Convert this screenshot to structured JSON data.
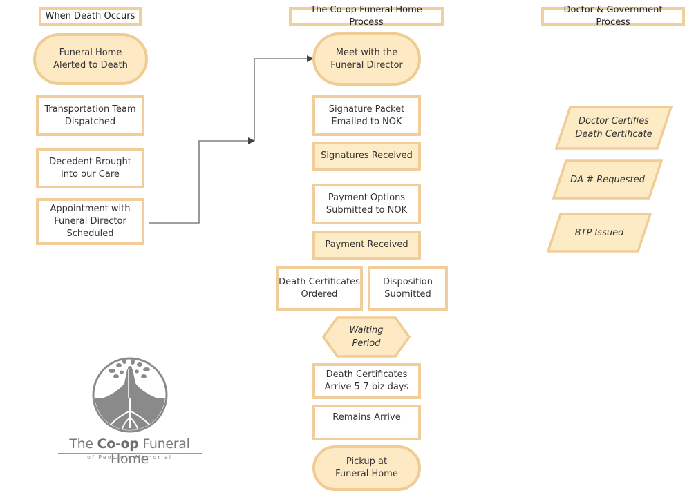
{
  "colors": {
    "border": "#f0cd96",
    "fill": "#fdebc6",
    "connector": "#7f7f7f",
    "arrowhead": "#444444",
    "logo_gray": "#8a8a8a"
  },
  "columns": {
    "left": {
      "header": "When Death Occurs",
      "steps": [
        {
          "shape": "terminator",
          "label": "Funeral Home\nAlerted to Death"
        },
        {
          "shape": "process",
          "label": "Transportation Team\nDispatched"
        },
        {
          "shape": "process",
          "label": "Decedent Brought\ninto our Care"
        },
        {
          "shape": "process",
          "label": "Appointment with\nFuneral Director\nScheduled"
        }
      ]
    },
    "middle": {
      "header": "The Co-op Funeral Home Process",
      "steps": [
        {
          "shape": "terminator",
          "label": "Meet with the\nFuneral Director"
        },
        {
          "shape": "process",
          "label": "Signature Packet\nEmailed to NOK"
        },
        {
          "shape": "process-filled",
          "label": "Signatures Received"
        },
        {
          "shape": "process",
          "label": "Payment Options\nSubmitted to NOK"
        },
        {
          "shape": "process-filled",
          "label": "Payment Received"
        },
        {
          "shape": "process",
          "label": "Death Certificates\nOrdered"
        },
        {
          "shape": "process",
          "label": "Disposition\nSubmitted"
        },
        {
          "shape": "preparation",
          "label": "Waiting\nPeriod"
        },
        {
          "shape": "process",
          "label": "Death Certificates\nArrive 5-7 biz days"
        },
        {
          "shape": "process",
          "label": "Remains Arrive"
        },
        {
          "shape": "terminator",
          "label": "Pickup at\nFuneral Home"
        }
      ]
    },
    "right": {
      "header": "Doctor & Government Process",
      "steps": [
        {
          "shape": "data",
          "label": "Doctor Certifies\nDeath Certificate"
        },
        {
          "shape": "data",
          "label": "DA # Requested"
        },
        {
          "shape": "data",
          "label": "BTP Issued"
        }
      ]
    }
  },
  "connectors": [
    {
      "from": "Appointment with Funeral Director Scheduled",
      "to": "Meet with the Funeral Director",
      "style": "elbow-with-arrows"
    }
  ],
  "logo": {
    "icon": "tree-of-life-icon",
    "title_prefix": "The ",
    "title_bold": "Co-op",
    "title_suffix": " Funeral Home",
    "subtitle": "of People's Memorial"
  }
}
